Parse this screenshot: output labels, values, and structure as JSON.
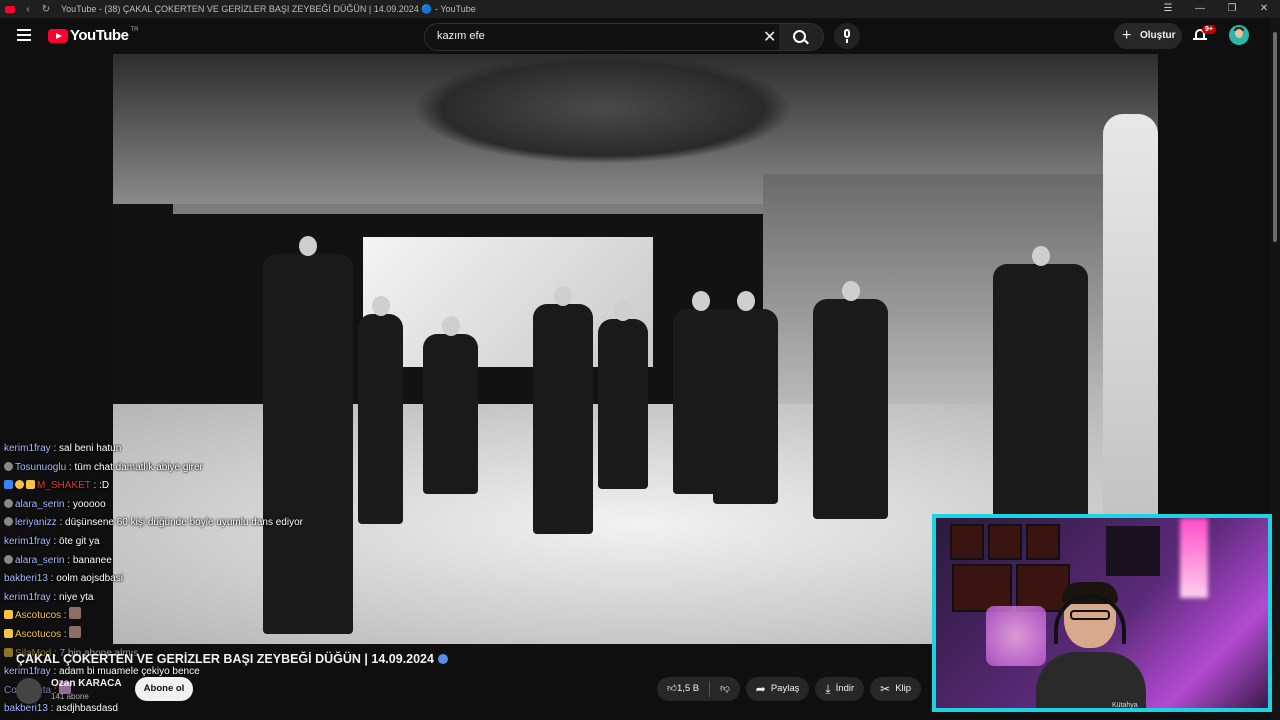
{
  "browser": {
    "tab_title": "YouTube - (38) ÇAKAL ÇOKERTEN VE GERİZLER BAŞI ZEYBEĞİ DÜĞÜN | 14.09.2024 🔵 - YouTube"
  },
  "header": {
    "logo_text": "YouTube",
    "logo_region": "TR",
    "search_value": "kazım efe",
    "create_label": "Oluştur",
    "notification_badge": "9+"
  },
  "chat": [
    {
      "user": "kerim1fray",
      "text": "sal beni hatun",
      "color": "blue"
    },
    {
      "user": "Tosunuoglu",
      "text": "tüm chat damatlık abiye girer",
      "color": "blue"
    },
    {
      "user": "M_SHAKET",
      "text": ":D",
      "color": "red"
    },
    {
      "user": "alara_serin",
      "text": "yooooo",
      "color": "blue"
    },
    {
      "user": "leriyanizz",
      "text": "düşünsene 60 kişi düğünde boyle uyumlu dans ediyor",
      "color": "blue"
    },
    {
      "user": "kerim1fray",
      "text": "öte git ya",
      "color": "blue"
    },
    {
      "user": "alara_serin",
      "text": "bananee",
      "color": "blue"
    },
    {
      "user": "bakberi13",
      "text": "oolm aojsdbasi",
      "color": "blue"
    },
    {
      "user": "kerim1fray",
      "text": "niye yta",
      "color": "blue"
    },
    {
      "user": "Ascotucos",
      "text": "",
      "color": "yellow"
    },
    {
      "user": "Ascotucos",
      "text": "",
      "color": "yellow"
    },
    {
      "user": "SilaMod",
      "text": "7 bin abone almıs",
      "color": "yellow"
    },
    {
      "user": "kerim1fray",
      "text": "adam bi muamele çekiyo bence",
      "color": "blue"
    },
    {
      "user": "CoreVanta",
      "text": "",
      "color": "blue"
    },
    {
      "user": "bakberi13",
      "text": "asdjhbasdasd",
      "color": "blue"
    }
  ],
  "video": {
    "title": "ÇAKAL ÇOKERTEN VE GERİZLER BAŞI ZEYBEĞİ DÜĞÜN | 14.09.2024",
    "channel_name": "Ozan KARACA",
    "channel_subs": "141 abone",
    "subscribe_label": "Abone ol",
    "like_count": "1,5 B",
    "share_label": "Paylaş",
    "download_label": "İndir",
    "clip_label": "Klip"
  },
  "webcam": {
    "caption": "Kütahya"
  },
  "colors": {
    "background": "#0f0f0f",
    "accent_red": "#ff0033",
    "webcam_border": "#1ed3e0",
    "chat_user": "#a7b9ff"
  }
}
